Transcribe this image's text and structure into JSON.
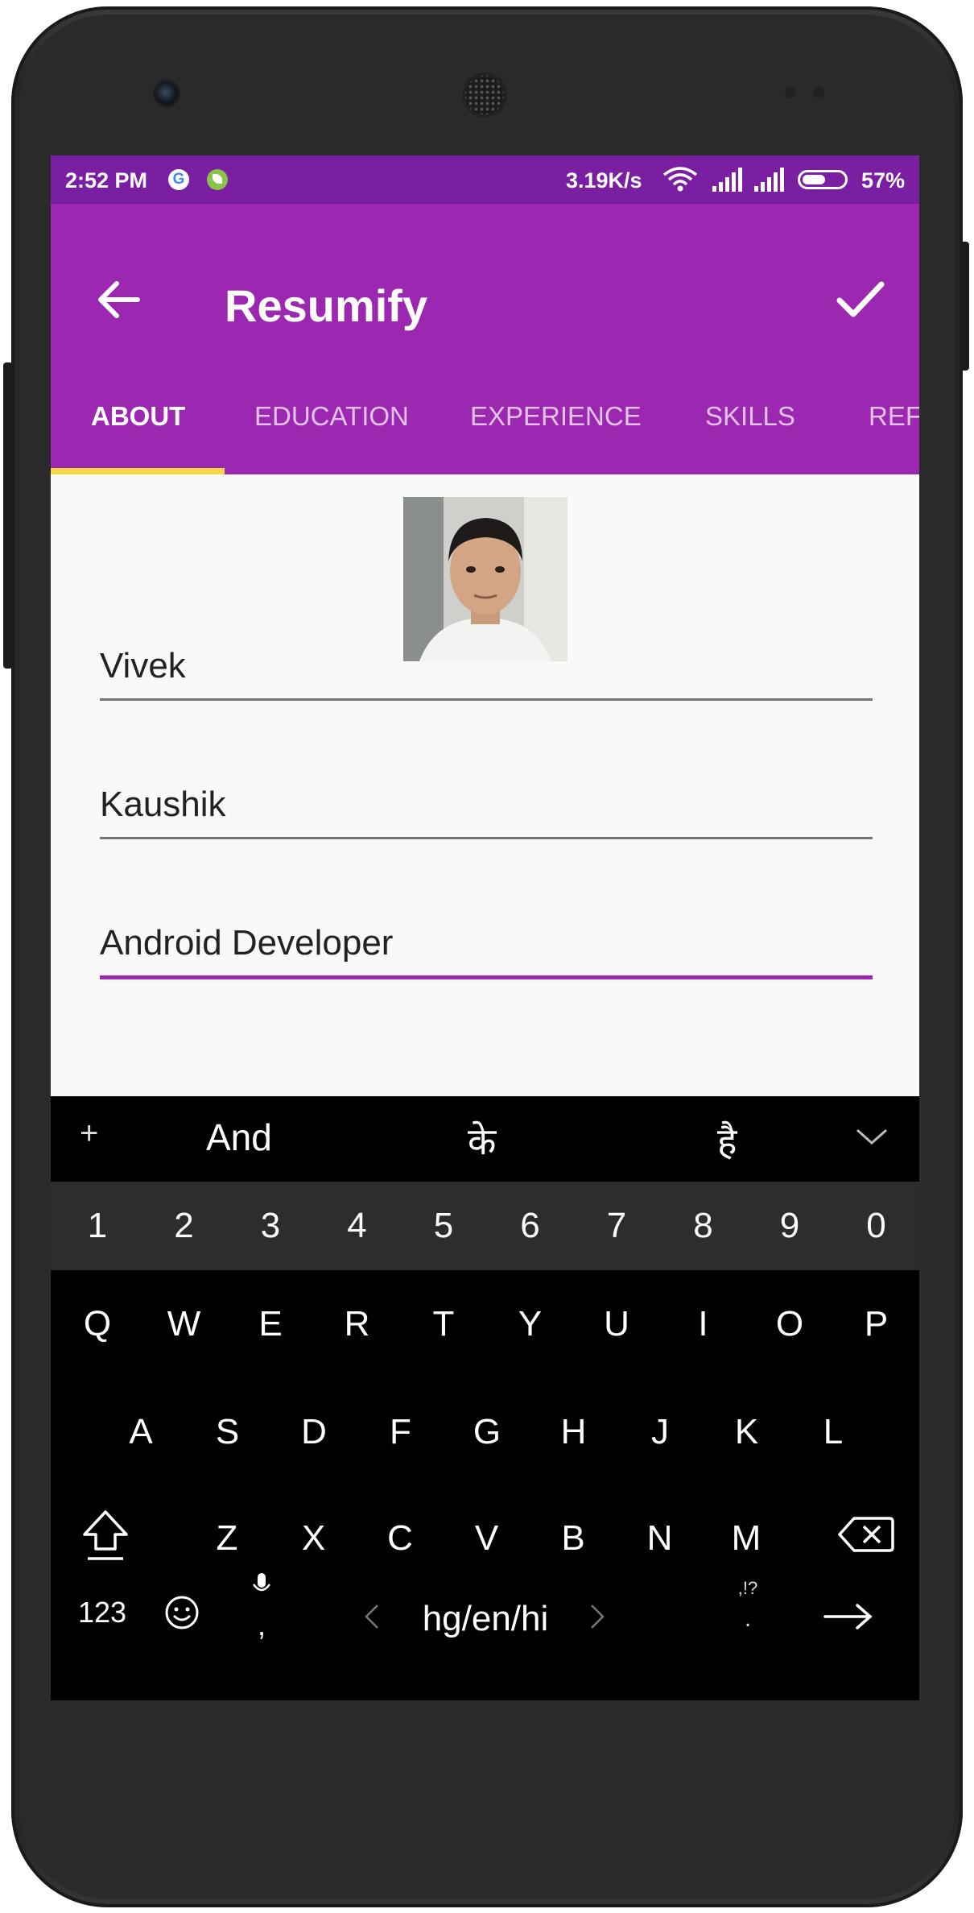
{
  "status_bar": {
    "time": "2:52 PM",
    "g_icon": "G",
    "net_speed": "3.19K/s",
    "battery_pct_label": "57%",
    "battery_level": 0.57
  },
  "app_bar": {
    "title": "Resumify",
    "back_icon": "arrow-left",
    "confirm_icon": "checkmark"
  },
  "tabs": [
    {
      "label": "ABOUT",
      "active": true
    },
    {
      "label": "EDUCATION",
      "active": false
    },
    {
      "label": "EXPERIENCE",
      "active": false
    },
    {
      "label": "SKILLS",
      "active": false
    },
    {
      "label": "REF",
      "active": false
    }
  ],
  "form": {
    "first_name": "Vivek",
    "last_name": "Kaushik",
    "headline": "Android Developer"
  },
  "keyboard": {
    "suggestions": [
      "And",
      "के",
      "है"
    ],
    "plus": "+",
    "number_row": [
      "1",
      "2",
      "3",
      "4",
      "5",
      "6",
      "7",
      "8",
      "9",
      "0"
    ],
    "row1": [
      "Q",
      "W",
      "E",
      "R",
      "T",
      "Y",
      "U",
      "I",
      "O",
      "P"
    ],
    "row2": [
      "A",
      "S",
      "D",
      "F",
      "G",
      "H",
      "J",
      "K",
      "L"
    ],
    "row3": [
      "Z",
      "X",
      "C",
      "V",
      "B",
      "N",
      "M"
    ],
    "symbols_key": "123",
    "comma_key": ",",
    "language_key": "hg/en/hi",
    "punct_key_top": ",!?",
    "punct_key_bottom": "."
  },
  "colors": {
    "primary": "#9c27b0",
    "primary_dark": "#7b1fa2",
    "accent_indicator": "#ffeb3b",
    "keyboard_bg": "#000000",
    "number_row_bg": "#2d2d2d"
  }
}
